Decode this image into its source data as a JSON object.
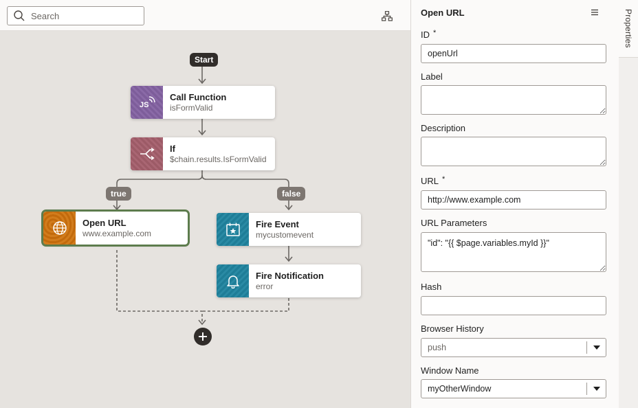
{
  "search": {
    "placeholder": "Search"
  },
  "flow": {
    "start_label": "Start",
    "branch_true": "true",
    "branch_false": "false",
    "nodes": {
      "call_function": {
        "title": "Call Function",
        "subtitle": "isFormValid"
      },
      "if": {
        "title": "If",
        "subtitle": "$chain.results.IsFormValid"
      },
      "open_url": {
        "title": "Open URL",
        "subtitle": "www.example.com"
      },
      "fire_event": {
        "title": "Fire Event",
        "subtitle": "mycustomevent"
      },
      "fire_notification": {
        "title": "Fire Notification",
        "subtitle": "error"
      }
    }
  },
  "panel": {
    "title": "Open URL",
    "side_tab": "Properties",
    "required_mark": "*",
    "id": {
      "label": "ID",
      "value": "openUrl"
    },
    "label": {
      "label": "Label",
      "value": ""
    },
    "description": {
      "label": "Description",
      "value": ""
    },
    "url": {
      "label": "URL",
      "value": "http://www.example.com"
    },
    "url_parameters": {
      "label": "URL Parameters",
      "value": "\"id\": \"{{ $page.variables.myId }}\""
    },
    "hash": {
      "label": "Hash",
      "value": ""
    },
    "browser_history": {
      "label": "Browser History",
      "value": "push"
    },
    "window_name": {
      "label": "Window Name",
      "value": "myOtherWindow"
    }
  },
  "colors": {
    "canvas_bg": "#e6e3df",
    "selected_outline": "#5d7c4d",
    "pill_dark": "#312d2a",
    "pill_grey": "#7d7671"
  }
}
